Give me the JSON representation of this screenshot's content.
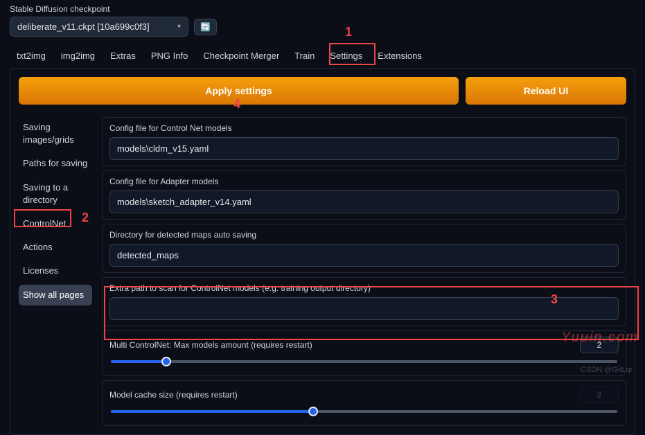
{
  "checkpoint": {
    "label": "Stable Diffusion checkpoint",
    "value": "deliberate_v11.ckpt [10a699c0f3]",
    "refresh_icon": "🔄"
  },
  "tabs": {
    "items": [
      "txt2img",
      "img2img",
      "Extras",
      "PNG Info",
      "Checkpoint Merger",
      "Train",
      "Settings",
      "Extensions"
    ],
    "active": "Settings"
  },
  "buttons": {
    "apply": "Apply settings",
    "reload": "Reload UI"
  },
  "sidebar": {
    "items": [
      "Saving images/grids",
      "Paths for saving",
      "Saving to a directory",
      "ControlNet",
      "Actions",
      "Licenses",
      "Show all pages"
    ],
    "active_index": 6
  },
  "settings": {
    "config_cn_label": "Config file for Control Net models",
    "config_cn_value": "models\\cldm_v15.yaml",
    "config_adapter_label": "Config file for Adapter models",
    "config_adapter_value": "models\\sketch_adapter_v14.yaml",
    "detected_dir_label": "Directory for detected maps auto saving",
    "detected_dir_value": "detected_maps",
    "extra_path_label": "Extra path to scan for ControlNet models (e.g. training output directory)",
    "extra_path_value": "",
    "multi_cn_label": "Multi ControlNet: Max models amount (requires restart)",
    "multi_cn_value": "2",
    "cache_label": "Model cache size (requires restart)",
    "cache_value": "2"
  },
  "annotations": {
    "a1": "1",
    "a2": "2",
    "a3": "3",
    "a4": "4"
  },
  "watermark": "Yuuin.com",
  "watermark2": "CSDN @GitLqr",
  "chart_data": {
    "type": "table",
    "note": "No chart present; UI is a settings form."
  }
}
